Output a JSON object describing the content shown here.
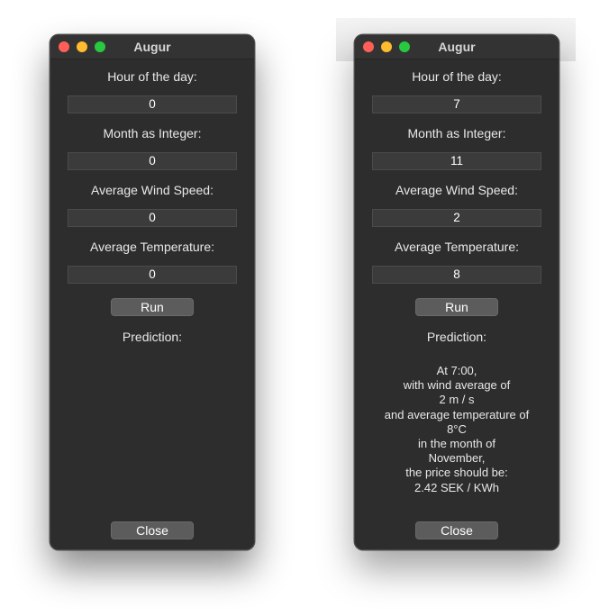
{
  "windows": [
    {
      "title": "Augur",
      "labels": {
        "hour": "Hour of the day:",
        "month": "Month as Integer:",
        "wind": "Average Wind Speed:",
        "temp": "Average Temperature:",
        "prediction": "Prediction:"
      },
      "fields": {
        "hour": "0",
        "month": "0",
        "wind": "0",
        "temp": "0"
      },
      "run_label": "Run",
      "close_label": "Close",
      "result_lines": []
    },
    {
      "title": "Augur",
      "labels": {
        "hour": "Hour of the day:",
        "month": "Month as Integer:",
        "wind": "Average Wind Speed:",
        "temp": "Average Temperature:",
        "prediction": "Prediction:"
      },
      "fields": {
        "hour": "7",
        "month": "11",
        "wind": "2",
        "temp": "8"
      },
      "run_label": "Run",
      "close_label": "Close",
      "result_lines": [
        "At 7:00,",
        "with wind average of",
        "2 m / s",
        "and average temperature of",
        "8°C",
        "in the month of",
        "November,",
        "the price should be:",
        "2.42 SEK / KWh"
      ]
    }
  ],
  "colors": {
    "window_bg": "#2d2d2d",
    "traffic_close": "#ff5f57",
    "traffic_minimize": "#febc2e",
    "traffic_zoom": "#28c840"
  }
}
